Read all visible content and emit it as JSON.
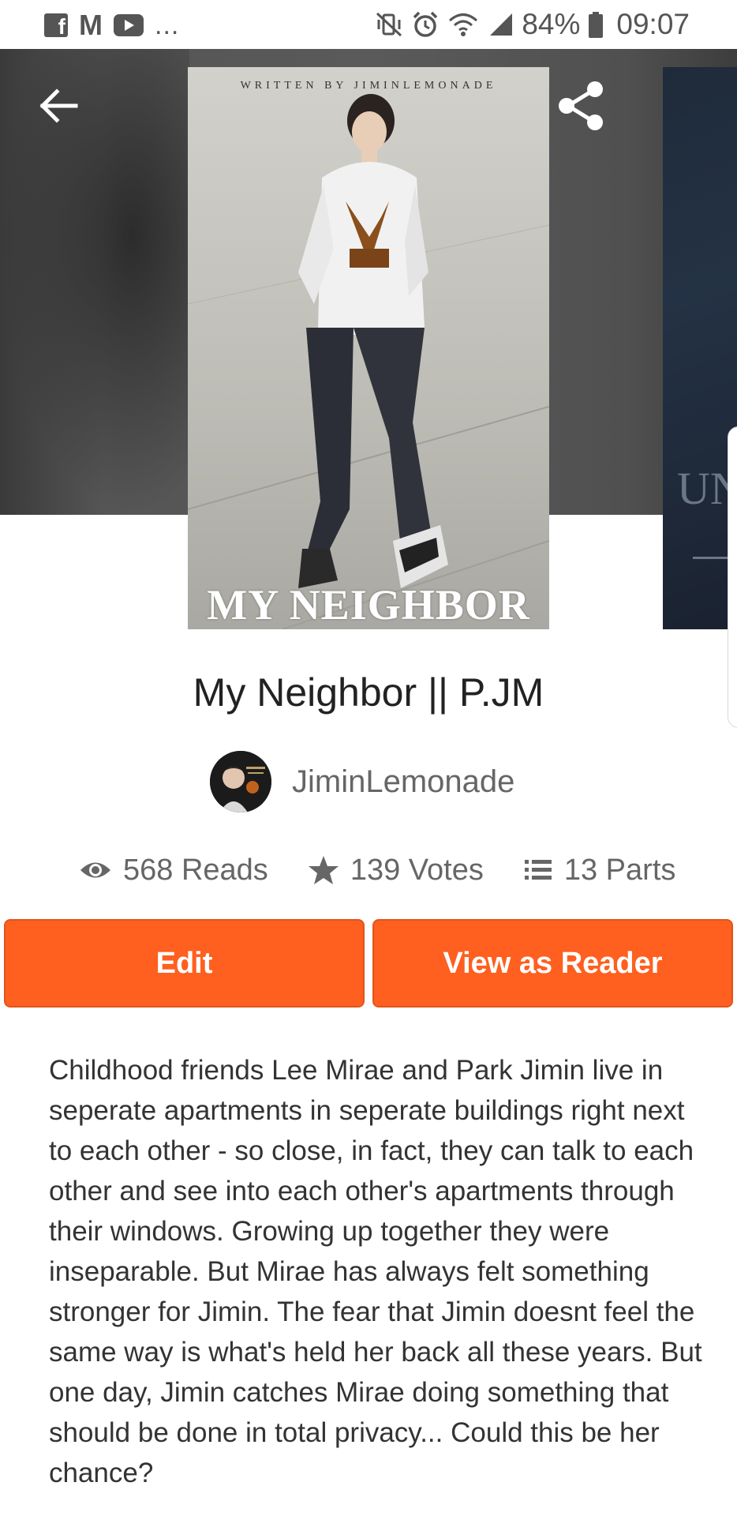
{
  "status_bar": {
    "notification_icons": [
      "facebook-icon",
      "gmail-icon",
      "youtube-icon"
    ],
    "more_label": "...",
    "battery": "84%",
    "time": "09:07"
  },
  "cover": {
    "credit": "WRITTEN BY JIMINLEMONADE",
    "title": "MY NEIGHBOR"
  },
  "next_cover": {
    "title_partial": "UN"
  },
  "story": {
    "title": "My Neighbor || P.JM",
    "author": "JiminLemonade",
    "stats": {
      "reads": "568 Reads",
      "votes": "139 Votes",
      "parts": "13 Parts"
    },
    "description": "Childhood friends Lee Mirae and Park Jimin live in seperate apartments in seperate buildings right next to each other - so close, in fact, they can talk to each other and see into each other's apartments through their windows. Growing up together they were inseparable. But Mirae has always felt something stronger for Jimin. The fear that Jimin doesnt feel the same way is what's held her back all these years. But one day, Jimin catches Mirae doing something that should be done in total privacy... Could this be her chance?"
  },
  "actions": {
    "edit_label": "Edit",
    "view_as_reader_label": "View as Reader"
  },
  "colors": {
    "accent": "#ff5f1f",
    "header_bg": "#555555",
    "text_muted": "#666666"
  }
}
